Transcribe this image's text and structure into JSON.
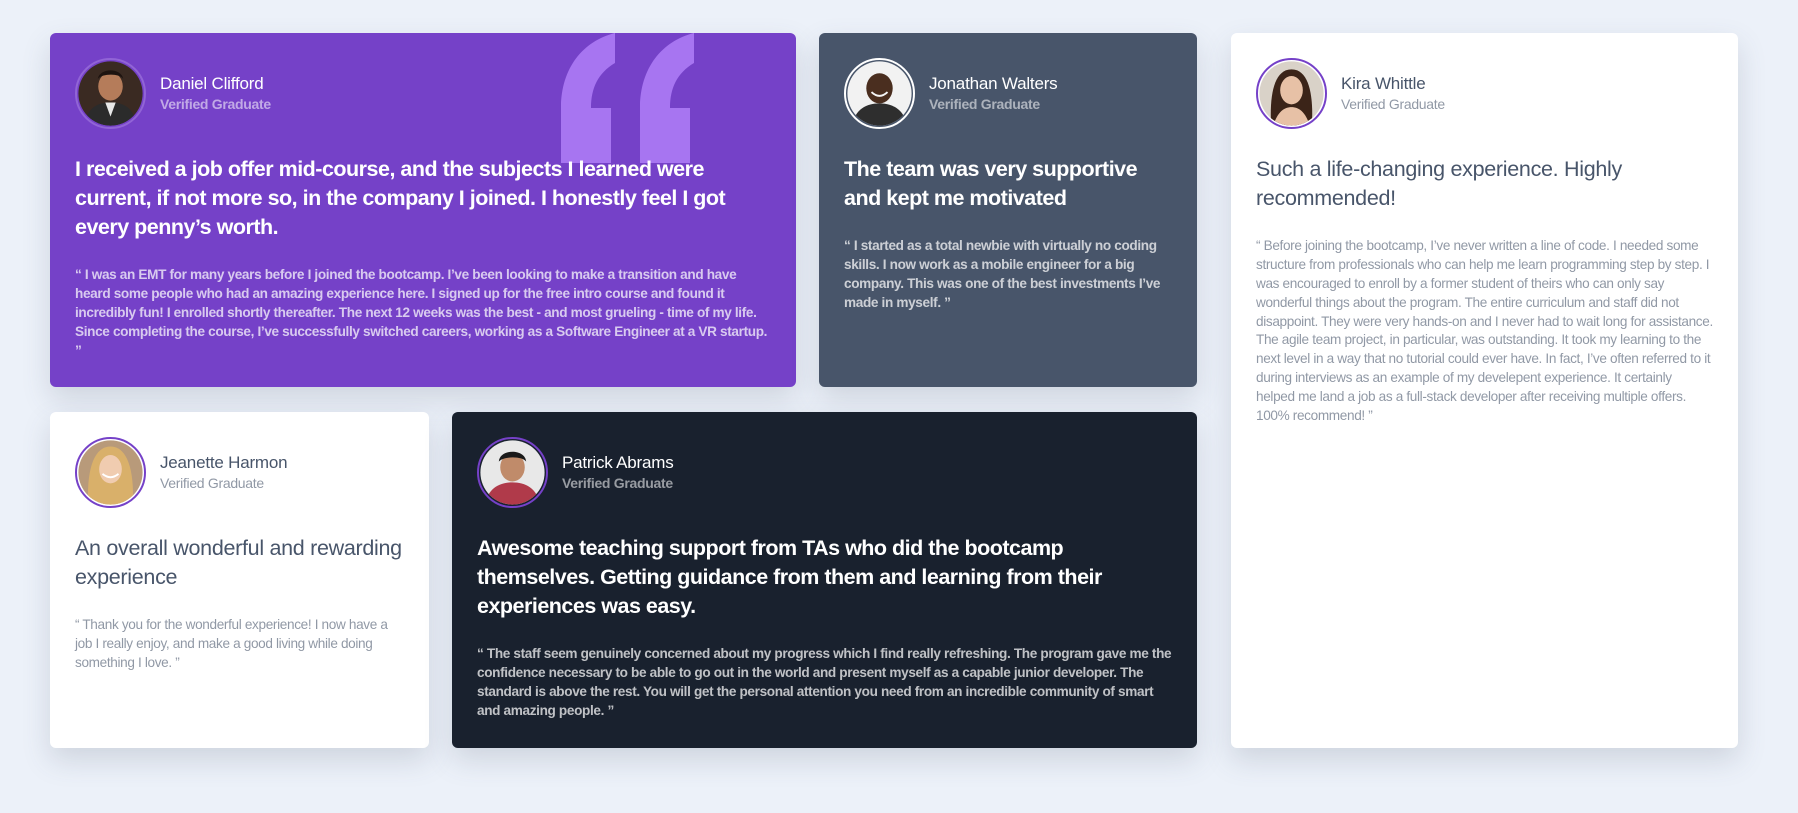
{
  "colors": {
    "background": "#ecf1f9",
    "purple": "#7541c8",
    "slate": "#48556a",
    "white": "#ffffff",
    "dark": "#19212e",
    "quote_mark": "#a775f1"
  },
  "testimonials": [
    {
      "name": "Daniel Clifford",
      "role": "Verified Graduate",
      "headline": "I received a job offer mid-course, and the subjects I learned were current, if not more so, in the company I joined. I honestly feel I got every penny’s worth.",
      "quote": "“ I was an EMT for many years before I joined the bootcamp. I’ve been looking to make a transition and have heard some people who had an amazing experience here. I signed up for the free intro course and found it incredibly fun! I enrolled shortly thereafter. The next 12 weeks was the best - and most grueling - time of my life. Since completing the course, I’ve successfully switched careers, working as a Software Engineer at a VR startup. ”",
      "avatar_icon": "daniel-avatar"
    },
    {
      "name": "Jonathan Walters",
      "role": "Verified Graduate",
      "headline": "The team was very supportive and kept me motivated",
      "quote": "“ I started as a total newbie with virtually no coding skills. I now work as a mobile engineer for a big company. This was one of the best investments I’ve made in myself. ”",
      "avatar_icon": "jonathan-avatar"
    },
    {
      "name": "Kira Whittle",
      "role": "Verified Graduate",
      "headline": "Such a life-changing experience. Highly recommended!",
      "quote": "“ Before joining the bootcamp, I’ve never written a line of code. I needed some structure from professionals who can help me learn programming step by step. I was encouraged to enroll by a former student of theirs who can only say wonderful things about the program. The entire curriculum and staff did not disappoint. They were very hands-on and I never had to wait long for assistance. The agile team project, in particular, was outstanding. It took my learning to the next level in a way that no tutorial could ever have. In fact, I’ve often referred to it during interviews as an example of my develepent experience. It certainly helped me land a job as a full-stack developer after receiving multiple offers. 100% recommend! ”",
      "avatar_icon": "kira-avatar"
    },
    {
      "name": "Jeanette Harmon",
      "role": "Verified Graduate",
      "headline": "An overall wonderful and rewarding experience",
      "quote": "“ Thank you for the wonderful experience! I now have a job I really enjoy, and make a good living while doing something I love. ”",
      "avatar_icon": "jeanette-avatar"
    },
    {
      "name": "Patrick Abrams",
      "role": "Verified Graduate",
      "headline": "Awesome teaching support from TAs who did the bootcamp themselves. Getting guidance from them and learning from their experiences was easy.",
      "quote": "“ The staff seem genuinely concerned about my progress which I find really refreshing. The program gave me the confidence necessary to be able to go out in the world and present myself as a capable junior developer. The standard is above the rest. You will get the personal attention you need from an incredible community of smart and amazing people. ”",
      "avatar_icon": "patrick-avatar"
    }
  ]
}
